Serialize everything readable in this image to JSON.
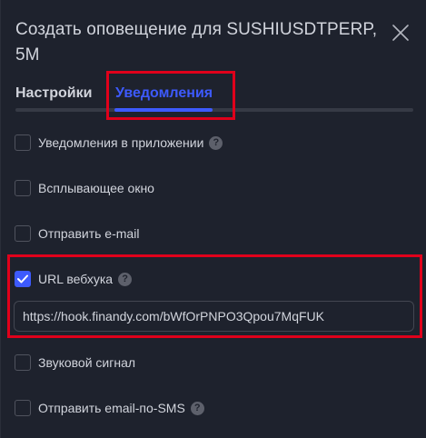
{
  "dialog": {
    "title": "Создать оповещение для SUSHIUSDTPERP, 5M"
  },
  "tabs": [
    {
      "label": "Настройки",
      "active": false
    },
    {
      "label": "Уведомления",
      "active": true
    }
  ],
  "options": [
    {
      "label": "Уведомления в приложении",
      "checked": false,
      "help": true
    },
    {
      "label": "Всплывающее окно",
      "checked": false,
      "help": false
    },
    {
      "label": "Отправить e-mail",
      "checked": false,
      "help": false
    },
    {
      "label": "URL вебхука",
      "checked": true,
      "help": true
    },
    {
      "label": "Звуковой сигнал",
      "checked": false,
      "help": false
    },
    {
      "label": "Отправить email-по-SMS",
      "checked": false,
      "help": true
    }
  ],
  "webhook": {
    "value": "https://hook.finandy.com/bWfOrPNPO3Qpou7MqFUK"
  },
  "help_glyph": "?",
  "colors": {
    "background": "#1e222d",
    "accent": "#3d5afe",
    "highlight": "#e0001b",
    "text": "#d1d4dc"
  }
}
